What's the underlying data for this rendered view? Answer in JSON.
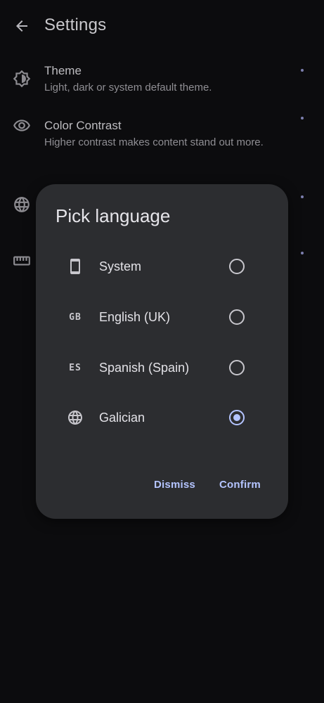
{
  "app_bar": {
    "title": "Settings",
    "back_icon": "arrow-back-icon"
  },
  "settings": {
    "items": [
      {
        "title": "Theme",
        "subtitle": "Light, dark or system default theme.",
        "icon": "brightness-icon"
      },
      {
        "title": "Color Contrast",
        "subtitle": "Higher contrast makes content stand out more.",
        "icon": "eye-icon"
      },
      {
        "icon": "globe-icon"
      },
      {
        "icon": "ruler-icon"
      }
    ]
  },
  "dialog": {
    "title": "Pick language",
    "options": [
      {
        "label": "System",
        "icon": "phone-icon",
        "icon_text": "",
        "selected": false
      },
      {
        "label": "English (UK)",
        "icon": "flag-gb-icon",
        "icon_text": "GB",
        "selected": false
      },
      {
        "label": "Spanish (Spain)",
        "icon": "flag-es-icon",
        "icon_text": "ES",
        "selected": false
      },
      {
        "label": "Galician",
        "icon": "globe-icon",
        "icon_text": "",
        "selected": true
      }
    ],
    "dismiss_label": "Dismiss",
    "confirm_label": "Confirm"
  },
  "colors": {
    "background": "#0c0c0e",
    "dialog_surface": "#2c2d30",
    "accent": "#b4c4ff"
  }
}
